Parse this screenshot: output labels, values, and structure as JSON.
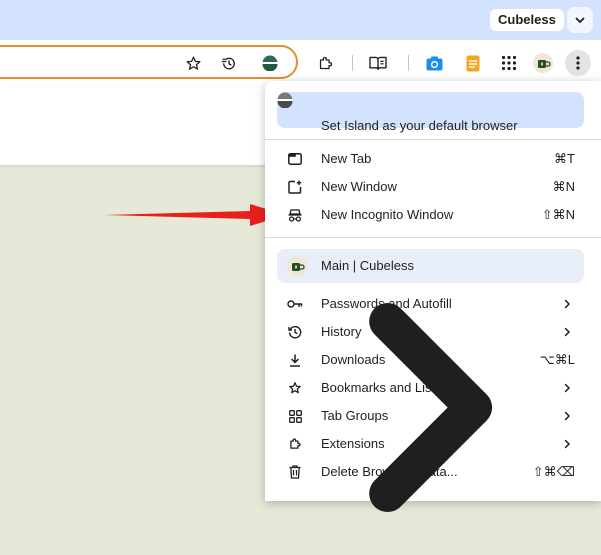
{
  "tab_strip": {
    "profile_chip": "Cubeless"
  },
  "toolbar": {
    "icons": [
      "star-icon",
      "performance-icon",
      "island-logo-icon",
      "extensions-icon",
      "reading-list-icon",
      "camera-icon",
      "notes-icon",
      "apps-grid-icon",
      "profile-avatar-icon",
      "more-menu-icon"
    ]
  },
  "menu": {
    "banner": "Set Island as your default browser",
    "new_tab": {
      "label": "New Tab",
      "shortcut": "⌘T"
    },
    "new_window": {
      "label": "New Window",
      "shortcut": "⌘N"
    },
    "new_incognito": {
      "label": "New Incognito Window",
      "shortcut": "⇧⌘N"
    },
    "profile": "Main | Cubeless",
    "passwords": {
      "label": "Passwords and Autofill"
    },
    "history": {
      "label": "History"
    },
    "downloads": {
      "label": "Downloads",
      "shortcut": "⌥⌘L"
    },
    "bookmarks": {
      "label": "Bookmarks and Lists"
    },
    "tab_groups": {
      "label": "Tab Groups"
    },
    "extensions": {
      "label": "Extensions"
    },
    "delete_data": {
      "label": "Delete Browsing Data...",
      "shortcut": "⇧⌘⌫"
    }
  },
  "colors": {
    "tab_strip": "#d3e3fd",
    "omnibox_border": "#e0902e",
    "page_bg": "#e6e9d8",
    "annotation_arrow": "#e8201b"
  }
}
